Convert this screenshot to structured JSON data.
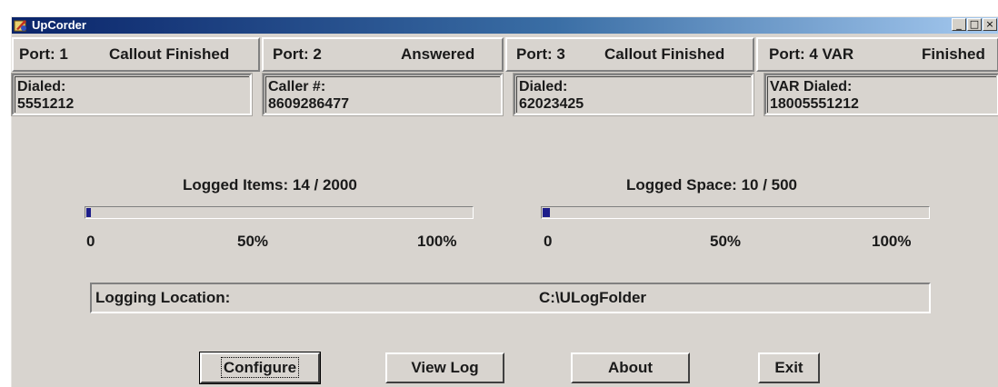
{
  "window": {
    "title": "UpCorder"
  },
  "title_buttons": {
    "minimize": "_",
    "maximize": "□",
    "close": "×"
  },
  "ports": [
    {
      "port_label": "Port:  1",
      "status": "Callout Finished",
      "info_label": "Dialed:",
      "info_value": "5551212"
    },
    {
      "port_label": "Port:  2",
      "status": "Answered",
      "info_label": "Caller #:",
      "info_value": "8609286477"
    },
    {
      "port_label": "Port:  3",
      "status": "Callout Finished",
      "info_label": "Dialed:",
      "info_value": "62023425"
    },
    {
      "port_label": "Port:  4  VAR",
      "status": "Finished",
      "info_label": "VAR Dialed:",
      "info_value": "18005551212"
    }
  ],
  "logged_items": {
    "label": "Logged Items: 14 / 2000",
    "fraction": 0.007,
    "scale": [
      "0",
      "50%",
      "100%"
    ]
  },
  "logged_space": {
    "label": "Logged Space: 10 / 500",
    "fraction": 0.02,
    "scale": [
      "0",
      "50%",
      "100%"
    ]
  },
  "logging_location": {
    "label": "Logging Location:",
    "value": "C:\\ULogFolder"
  },
  "buttons": {
    "configure": "Configure",
    "view_log": "View Log",
    "about": "About",
    "exit": "Exit"
  },
  "colors": {
    "progress_fill": "#1e1e8a",
    "title_bar": "#0a246a"
  }
}
